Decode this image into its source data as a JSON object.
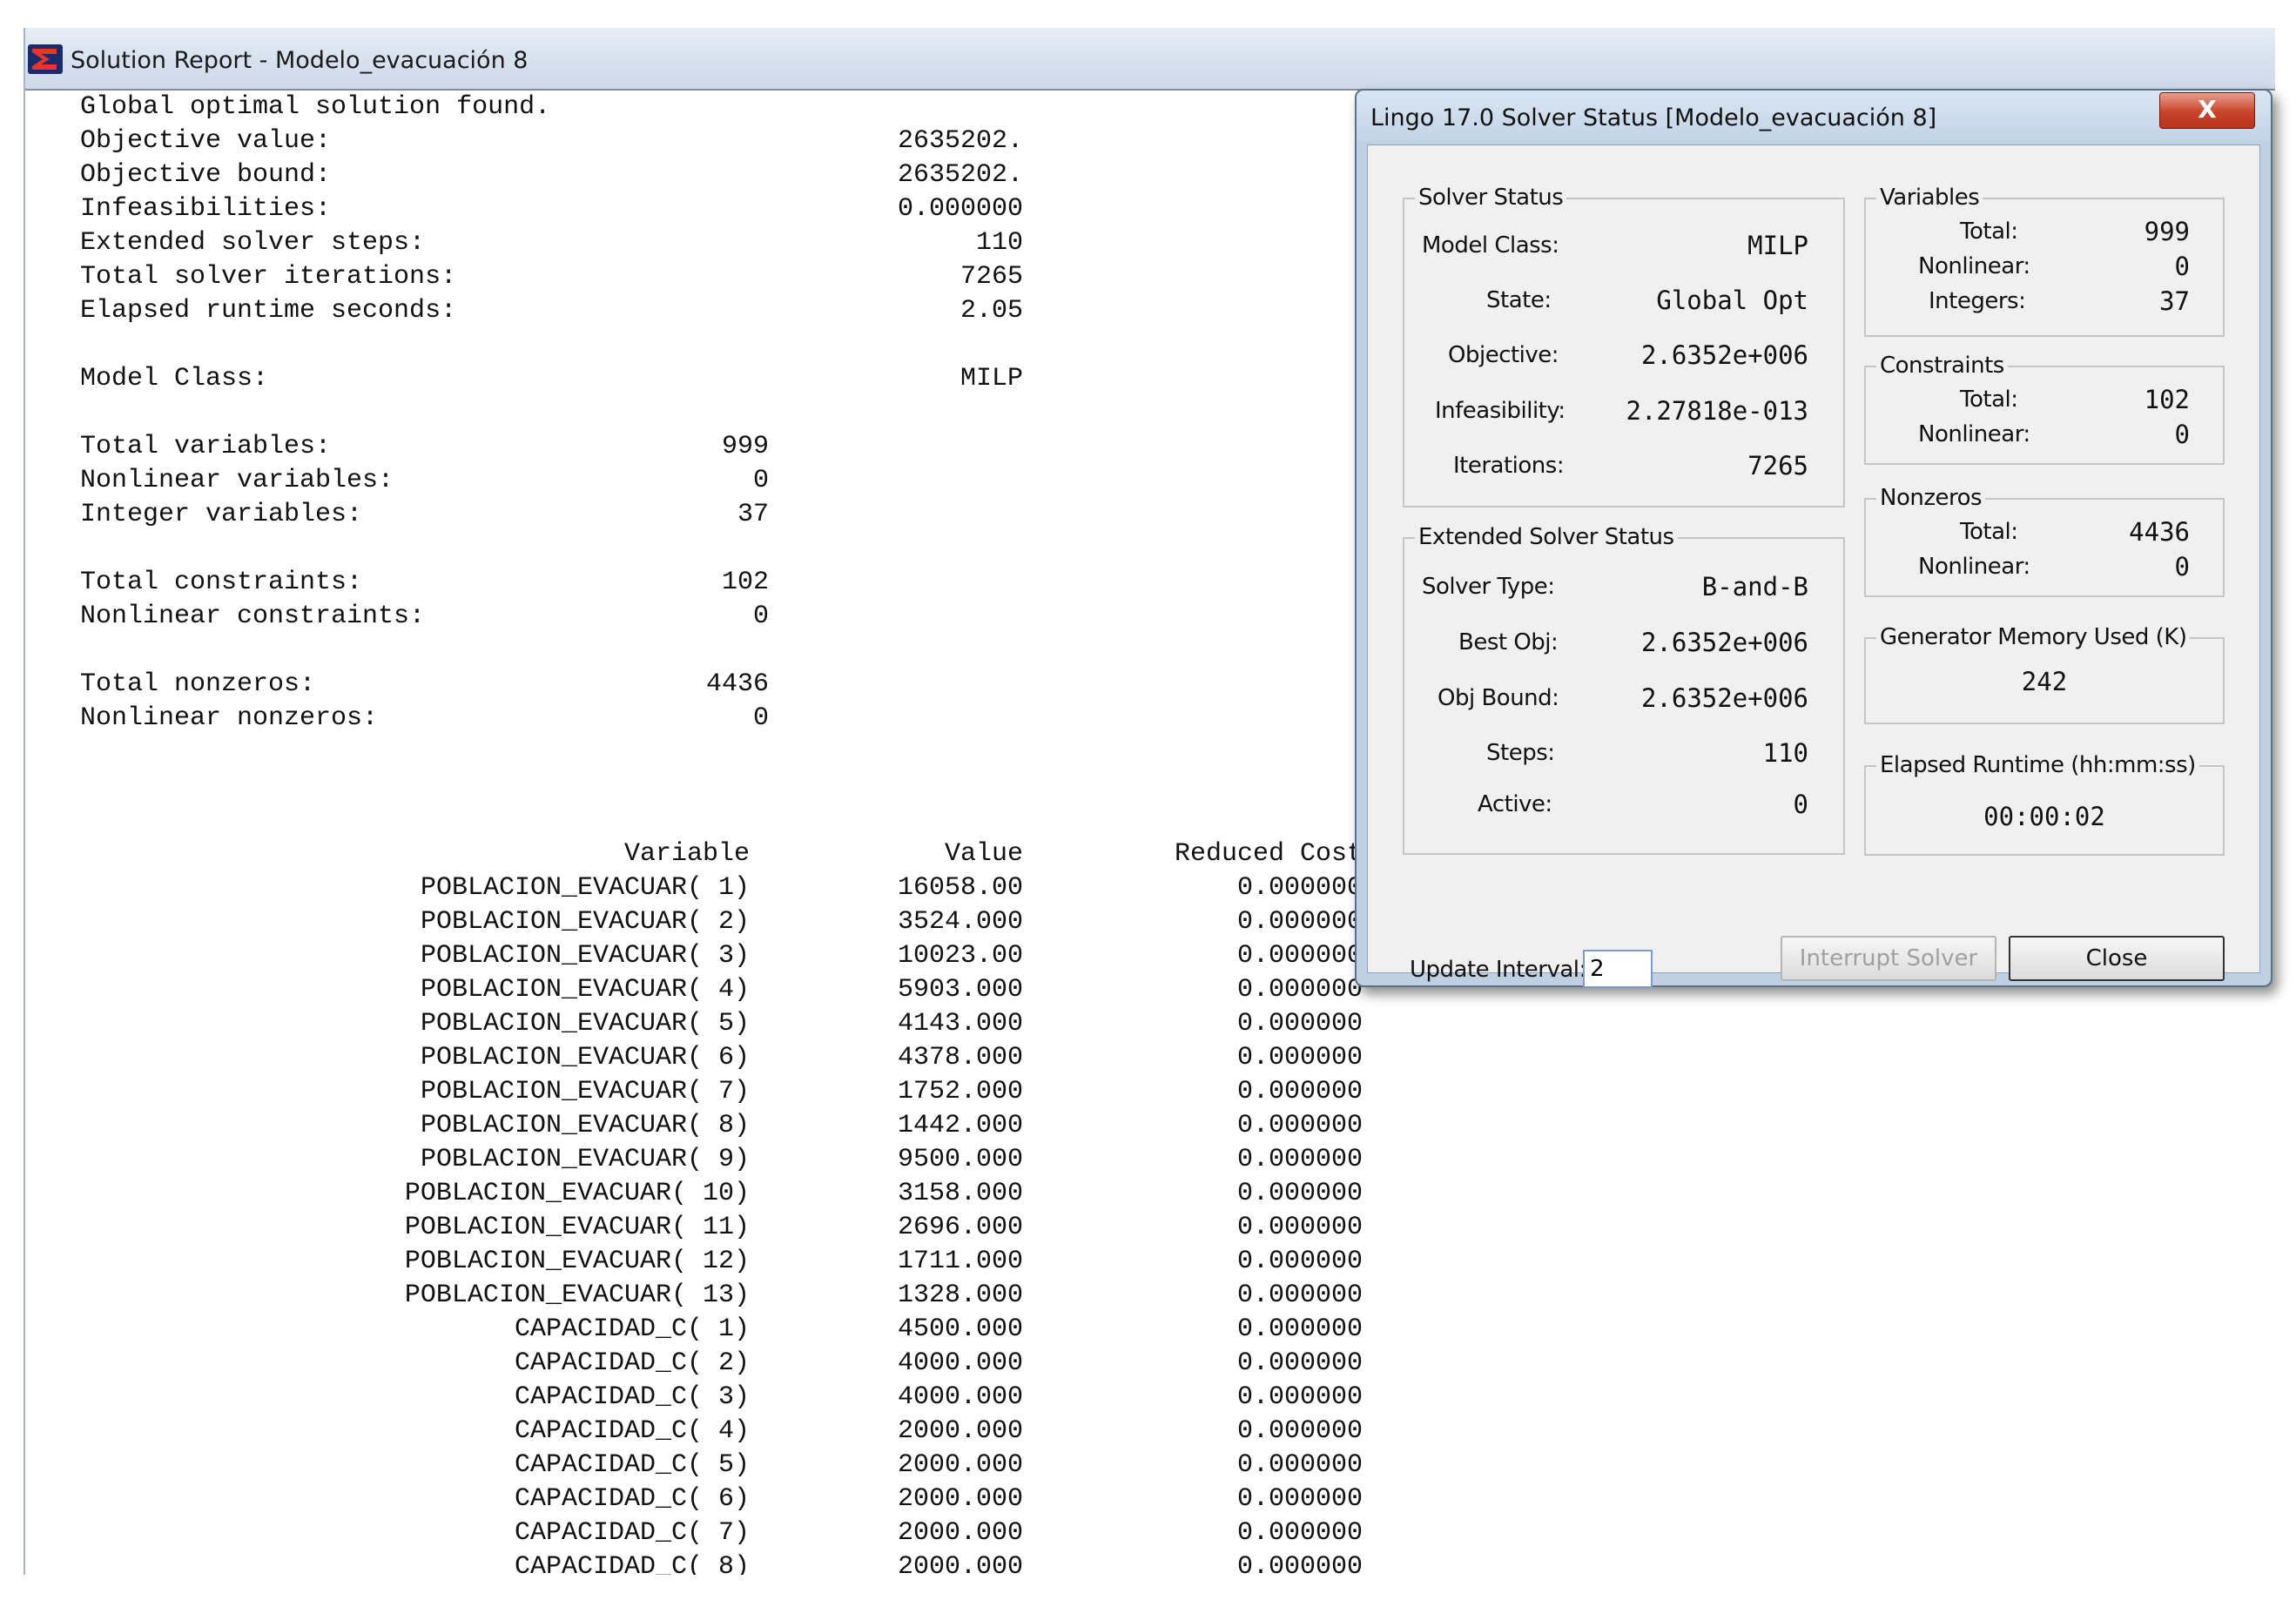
{
  "report": {
    "title": "Solution Report - Modelo_evacuación 8",
    "status_line": "Global optimal solution found.",
    "summary": [
      {
        "label": "Objective value:",
        "value": "2635202."
      },
      {
        "label": "Objective bound:",
        "value": "2635202."
      },
      {
        "label": "Infeasibilities:",
        "value": "0.000000"
      },
      {
        "label": "Extended solver steps:",
        "value": "110"
      },
      {
        "label": "Total solver iterations:",
        "value": "7265"
      },
      {
        "label": "Elapsed runtime seconds:",
        "value": "2.05"
      }
    ],
    "model_class": {
      "label": "Model Class:",
      "value": "MILP"
    },
    "counts": [
      {
        "label": "Total variables:",
        "value": "999"
      },
      {
        "label": "Nonlinear variables:",
        "value": "0"
      },
      {
        "label": "Integer variables:",
        "value": "37"
      },
      {
        "label": "Total constraints:",
        "value": "102"
      },
      {
        "label": "Nonlinear constraints:",
        "value": "0"
      },
      {
        "label": "Total nonzeros:",
        "value": "4436"
      },
      {
        "label": "Nonlinear nonzeros:",
        "value": "0"
      }
    ],
    "table": {
      "headers": {
        "variable": "Variable",
        "value": "Value",
        "reduced_cost": "Reduced Cost"
      },
      "rows": [
        {
          "variable": "POBLACION_EVACUAR( 1)",
          "value": "16058.00",
          "reduced_cost": "0.000000"
        },
        {
          "variable": "POBLACION_EVACUAR( 2)",
          "value": "3524.000",
          "reduced_cost": "0.000000"
        },
        {
          "variable": "POBLACION_EVACUAR( 3)",
          "value": "10023.00",
          "reduced_cost": "0.000000"
        },
        {
          "variable": "POBLACION_EVACUAR( 4)",
          "value": "5903.000",
          "reduced_cost": "0.000000"
        },
        {
          "variable": "POBLACION_EVACUAR( 5)",
          "value": "4143.000",
          "reduced_cost": "0.000000"
        },
        {
          "variable": "POBLACION_EVACUAR( 6)",
          "value": "4378.000",
          "reduced_cost": "0.000000"
        },
        {
          "variable": "POBLACION_EVACUAR( 7)",
          "value": "1752.000",
          "reduced_cost": "0.000000"
        },
        {
          "variable": "POBLACION_EVACUAR( 8)",
          "value": "1442.000",
          "reduced_cost": "0.000000"
        },
        {
          "variable": "POBLACION_EVACUAR( 9)",
          "value": "9500.000",
          "reduced_cost": "0.000000"
        },
        {
          "variable": "POBLACION_EVACUAR( 10)",
          "value": "3158.000",
          "reduced_cost": "0.000000"
        },
        {
          "variable": "POBLACION_EVACUAR( 11)",
          "value": "2696.000",
          "reduced_cost": "0.000000"
        },
        {
          "variable": "POBLACION_EVACUAR( 12)",
          "value": "1711.000",
          "reduced_cost": "0.000000"
        },
        {
          "variable": "POBLACION_EVACUAR( 13)",
          "value": "1328.000",
          "reduced_cost": "0.000000"
        },
        {
          "variable": "CAPACIDAD_C( 1)",
          "value": "4500.000",
          "reduced_cost": "0.000000"
        },
        {
          "variable": "CAPACIDAD_C( 2)",
          "value": "4000.000",
          "reduced_cost": "0.000000"
        },
        {
          "variable": "CAPACIDAD_C( 3)",
          "value": "4000.000",
          "reduced_cost": "0.000000"
        },
        {
          "variable": "CAPACIDAD_C( 4)",
          "value": "2000.000",
          "reduced_cost": "0.000000"
        },
        {
          "variable": "CAPACIDAD_C( 5)",
          "value": "2000.000",
          "reduced_cost": "0.000000"
        },
        {
          "variable": "CAPACIDAD_C( 6)",
          "value": "2000.000",
          "reduced_cost": "0.000000"
        },
        {
          "variable": "CAPACIDAD_C( 7)",
          "value": "2000.000",
          "reduced_cost": "0.000000"
        },
        {
          "variable": "CAPACIDAD_C( 8)",
          "value": "2000.000",
          "reduced_cost": "0.000000"
        }
      ]
    }
  },
  "solver_dialog": {
    "title": "Lingo 17.0 Solver Status [Modelo_evacuación 8]",
    "close_glyph": "X",
    "solver_status": {
      "legend": "Solver Status",
      "fields": [
        {
          "label": "Model Class:",
          "value": "MILP"
        },
        {
          "label": "State:",
          "value": "Global Opt"
        },
        {
          "label": "Objective:",
          "value": "2.6352e+006"
        },
        {
          "label": "Infeasibility:",
          "value": "2.27818e-013"
        },
        {
          "label": "Iterations:",
          "value": "7265"
        }
      ]
    },
    "extended_status": {
      "legend": "Extended Solver Status",
      "fields": [
        {
          "label": "Solver Type:",
          "value": "B-and-B"
        },
        {
          "label": "Best Obj:",
          "value": "2.6352e+006"
        },
        {
          "label": "Obj Bound:",
          "value": "2.6352e+006"
        },
        {
          "label": "Steps:",
          "value": "110"
        },
        {
          "label": "Active:",
          "value": "0"
        }
      ]
    },
    "variables": {
      "legend": "Variables",
      "fields": [
        {
          "label": "Total:",
          "value": "999"
        },
        {
          "label": "Nonlinear:",
          "value": "0"
        },
        {
          "label": "Integers:",
          "value": "37"
        }
      ]
    },
    "constraints": {
      "legend": "Constraints",
      "fields": [
        {
          "label": "Total:",
          "value": "102"
        },
        {
          "label": "Nonlinear:",
          "value": "0"
        }
      ]
    },
    "nonzeros": {
      "legend": "Nonzeros",
      "fields": [
        {
          "label": "Total:",
          "value": "4436"
        },
        {
          "label": "Nonlinear:",
          "value": "0"
        }
      ]
    },
    "generator_memory": {
      "legend": "Generator Memory Used (K)",
      "value": "242"
    },
    "elapsed_runtime": {
      "legend": "Elapsed Runtime (hh:mm:ss)",
      "value": "00:00:02"
    },
    "update_interval": {
      "label": "Update Interval:",
      "value": "2"
    },
    "buttons": {
      "interrupt": "Interrupt Solver",
      "close": "Close"
    }
  },
  "colors": {
    "titlebar": "#d6e0ee",
    "dialog_frame": "#bfd0e3",
    "close_button": "#c8432b",
    "dialog_client": "#f0f0f0"
  },
  "icons": [
    "lingo-app-icon",
    "close-x-icon"
  ]
}
